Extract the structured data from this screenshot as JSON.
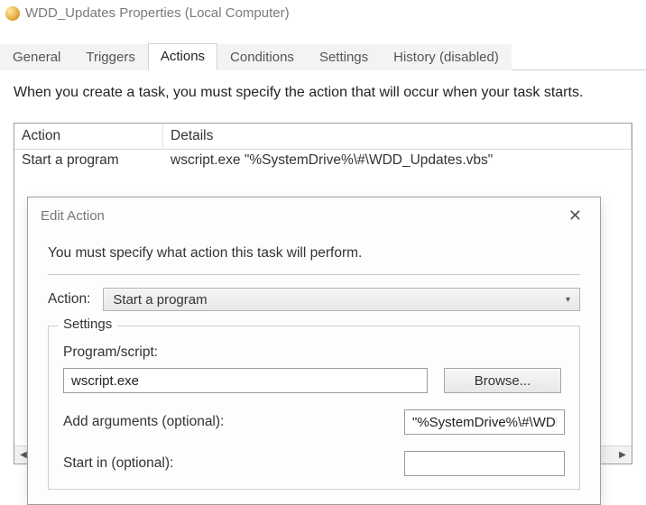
{
  "window": {
    "title": "WDD_Updates Properties (Local Computer)"
  },
  "tabs": {
    "general": "General",
    "triggers": "Triggers",
    "actions": "Actions",
    "conditions": "Conditions",
    "settings": "Settings",
    "history": "History (disabled)",
    "active_index": 2
  },
  "intro": "When you create a task, you must specify the action that will occur when your task starts.",
  "list": {
    "headers": {
      "action": "Action",
      "details": "Details"
    },
    "rows": [
      {
        "action": "Start a program",
        "details": "wscript.exe \"%SystemDrive%\\#\\WDD_Updates.vbs\""
      }
    ]
  },
  "dialog": {
    "title": "Edit Action",
    "intro": "You must specify what action this task will perform.",
    "action_label": "Action:",
    "action_value": "Start a program",
    "group_label": "Settings",
    "program_label": "Program/script:",
    "program_value": "wscript.exe",
    "browse_label": "Browse...",
    "args_label": "Add arguments (optional):",
    "args_value": "\"%SystemDrive%\\#\\WDD",
    "startin_label": "Start in (optional):",
    "startin_value": ""
  }
}
